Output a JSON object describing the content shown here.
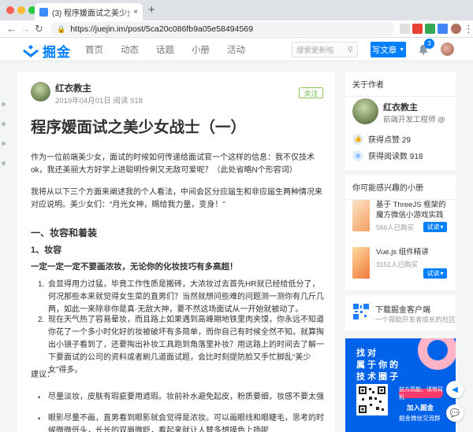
{
  "browser": {
    "tab_title": "(3) 程序媛面试之美少女战士（一",
    "tab_close": "×",
    "new_tab": "+",
    "url": "https://juejin.im/post/5ca20c086fb9a05e58494569",
    "nav_back": "←",
    "nav_forward": "→",
    "nav_reload": "↻"
  },
  "header": {
    "logo_text": "掘金",
    "nav": [
      "首页",
      "动态",
      "话题",
      "小册",
      "活动"
    ],
    "search_placeholder": "搜索更新啦",
    "write_label": "写文章",
    "notifications": "3"
  },
  "article": {
    "author_name": "红衣教主",
    "author_meta": "2019年04月01日  阅读 918",
    "follow_label": "关注",
    "title": "程序媛面试之美少女战士（一）",
    "intro_1": "作为一位前端美少女，面试的时候如何传递给面试官一个这样的信息：我不仅技术ok，我还美丽大方好学上进聪明伶俐又无敌可爱呢？（此处省略N个形容词）",
    "intro_2": "我将从以下三个方面来阐述我的个人看法，中间会区分应届生和非应届生两种情况来对应说明。美少女们：“月光女神，赐给我力量，变身！”",
    "section_1": "一、妆容和着装",
    "sub_1": "1、妆容",
    "bold_1": "一定一定一定不要画浓妆，无论你的化妆技巧有多高超！",
    "list": [
      {
        "num": "1.",
        "text": "会显得用力过猛，毕竟工作性质是搬砖，大浓妆过去首先HR就已经给低分了，何况那些本来就觉得女生菜的直男们？当然就想问些难的问题测一测你有几斤几两，如此一来除非你是真·无敌大神，要不然这场面试从一开始就被动了。"
      },
      {
        "num": "2.",
        "text": "现在天气热了容易晕妆，而且路上如果遇到高峰期地铁里肉夹馍，你永远不知道你花了一个多小时化好的妆被破坏有多简单，而你自己有时候全然不知。就算掏出小镜子看到了，还要掏出补妆工具跑到角落里补妆？用这路上的时间去了解一下要面试的公司的资料或者刷几道面试题，会比时刻提防脸又手忙脚乱“美少女”得多。"
      }
    ],
    "advice_label": "建议：",
    "bullets": [
      "尽量淡妆，皮肤有瑕疵要用遮瑕。妆前补水避免起皮，粉质要细，妆感不要太强",
      "眼影尽量不画，直男看到眼影就会觉得是浓妆。可以画眼线和眼睫毛，思考的时候微微低头，长长的双眉微眨，看起来就让人替多想摸色上扬呢"
    ]
  },
  "sidebar": {
    "about_title": "关于作者",
    "author_name": "红衣教主",
    "author_role": "前端开发工程师 @",
    "likes": "获得点赞 29",
    "reads": "获得阅读数 918",
    "books_title": "你可能感兴趣的小册",
    "books": [
      {
        "title": "基于 ThreeJS 框架的魔方微信小游戏实践",
        "count": "566人已购买",
        "try": "试读"
      },
      {
        "title": "Vue.js 组件精讲",
        "count": "3151人已购买",
        "try": "试读"
      }
    ],
    "app_title": "下载掘金客户端",
    "app_sub": "一个帮助开发者成长的社区"
  },
  "ad": {
    "line1": "找 对",
    "line2": "属 于 你 的",
    "line3": "技 术 圈 子",
    "btn": "前方高能，请带耳机",
    "line4": "加入掘金",
    "line5": "掘金微信交流群"
  },
  "colors": {
    "brand": "#007fff",
    "follow_green": "#6cbd45",
    "page_bg": "#f4f5f5"
  }
}
